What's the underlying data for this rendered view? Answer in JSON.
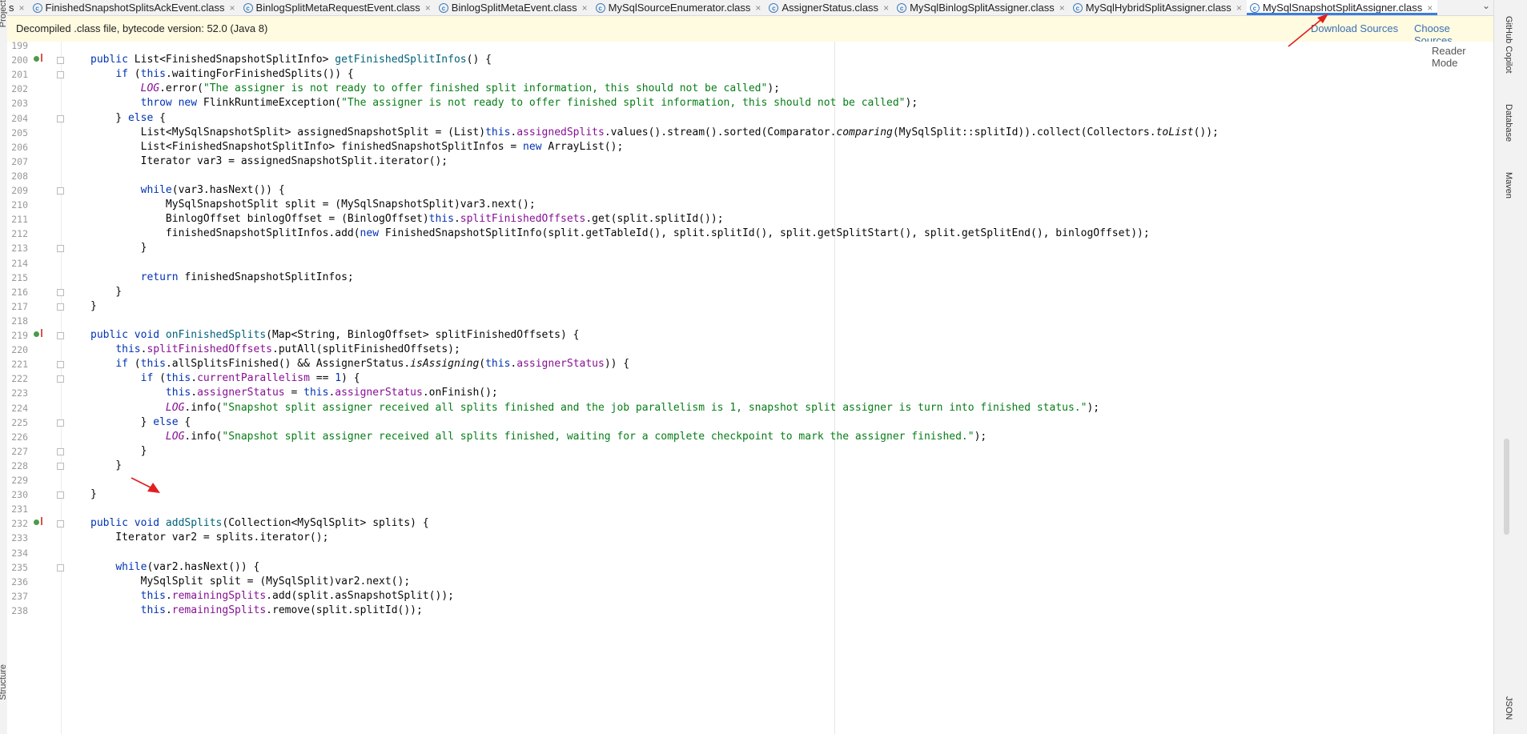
{
  "tabs": [
    {
      "label": "s",
      "active": false,
      "icon": "class-file-icon"
    },
    {
      "label": "FinishedSnapshotSplitsAckEvent.class",
      "active": false,
      "icon": "class-file-icon"
    },
    {
      "label": "BinlogSplitMetaRequestEvent.class",
      "active": false,
      "icon": "class-file-icon"
    },
    {
      "label": "BinlogSplitMetaEvent.class",
      "active": false,
      "icon": "class-file-icon"
    },
    {
      "label": "MySqlSourceEnumerator.class",
      "active": false,
      "icon": "class-file-icon"
    },
    {
      "label": "AssignerStatus.class",
      "active": false,
      "icon": "class-file-icon"
    },
    {
      "label": "MySqlBinlogSplitAssigner.class",
      "active": false,
      "icon": "class-file-icon"
    },
    {
      "label": "MySqlHybridSplitAssigner.class",
      "active": false,
      "icon": "class-file-icon"
    },
    {
      "label": "MySqlSnapshotSplitAssigner.class",
      "active": true,
      "icon": "class-file-icon"
    }
  ],
  "banner": {
    "message": "Decompiled .class file, bytecode version: 52.0 (Java 8)",
    "download_sources": "Download Sources",
    "choose_sources": "Choose Sources..."
  },
  "editor": {
    "reader_mode": "Reader Mode",
    "lines": [
      {
        "n": "199",
        "marker": false,
        "fold": false,
        "code": ""
      },
      {
        "n": "200",
        "marker": true,
        "fold": true,
        "code": "<span class=\"kw\">public</span> List&lt;FinishedSnapshotSplitInfo&gt; <span class=\"mth\">getFinishedSplitInfos</span>() {"
      },
      {
        "n": "201",
        "marker": false,
        "fold": true,
        "code": "    <span class=\"kw\">if</span> (<span class=\"kw\">this</span>.waitingForFinishedSplits()) {"
      },
      {
        "n": "202",
        "marker": false,
        "fold": false,
        "code": "        <span class=\"fld it\">LOG</span>.error(<span class=\"str\">\"The assigner is not ready to offer finished split information, this should not be called\"</span>);"
      },
      {
        "n": "203",
        "marker": false,
        "fold": false,
        "code": "        <span class=\"kw\">throw new</span> FlinkRuntimeException(<span class=\"str\">\"The assigner is not ready to offer finished split information, this should not be called\"</span>);"
      },
      {
        "n": "204",
        "marker": false,
        "fold": true,
        "code": "    } <span class=\"kw\">else</span> {"
      },
      {
        "n": "205",
        "marker": false,
        "fold": false,
        "code": "        List&lt;MySqlSnapshotSplit&gt; assignedSnapshotSplit = (List)<span class=\"kw\">this</span>.<span class=\"fld\">assignedSplits</span>.values().stream().sorted(Comparator.<span class=\"it\">comparing</span>(MySqlSplit::splitId)).collect(Collectors.<span class=\"it\">toList</span>());"
      },
      {
        "n": "206",
        "marker": false,
        "fold": false,
        "code": "        List&lt;FinishedSnapshotSplitInfo&gt; finishedSnapshotSplitInfos = <span class=\"kw\">new</span> ArrayList();"
      },
      {
        "n": "207",
        "marker": false,
        "fold": false,
        "code": "        Iterator var3 = assignedSnapshotSplit.iterator();"
      },
      {
        "n": "208",
        "marker": false,
        "fold": false,
        "code": ""
      },
      {
        "n": "209",
        "marker": false,
        "fold": true,
        "code": "        <span class=\"kw\">while</span>(var3.hasNext()) {"
      },
      {
        "n": "210",
        "marker": false,
        "fold": false,
        "code": "            MySqlSnapshotSplit split = (MySqlSnapshotSplit)var3.next();"
      },
      {
        "n": "211",
        "marker": false,
        "fold": false,
        "code": "            BinlogOffset binlogOffset = (BinlogOffset)<span class=\"kw\">this</span>.<span class=\"fld\">splitFinishedOffsets</span>.get(split.splitId());"
      },
      {
        "n": "212",
        "marker": false,
        "fold": false,
        "code": "            finishedSnapshotSplitInfos.add(<span class=\"kw\">new</span> FinishedSnapshotSplitInfo(split.getTableId(), split.splitId(), split.getSplitStart(), split.getSplitEnd(), binlogOffset));"
      },
      {
        "n": "213",
        "marker": false,
        "fold": true,
        "code": "        }"
      },
      {
        "n": "214",
        "marker": false,
        "fold": false,
        "code": ""
      },
      {
        "n": "215",
        "marker": false,
        "fold": false,
        "code": "        <span class=\"kw\">return</span> finishedSnapshotSplitInfos;"
      },
      {
        "n": "216",
        "marker": false,
        "fold": true,
        "code": "    }"
      },
      {
        "n": "217",
        "marker": false,
        "fold": true,
        "code": "}"
      },
      {
        "n": "218",
        "marker": false,
        "fold": false,
        "code": ""
      },
      {
        "n": "219",
        "marker": true,
        "fold": true,
        "code": "<span class=\"kw\">public void</span> <span class=\"mth\">onFinishedSplits</span>(Map&lt;String, BinlogOffset&gt; splitFinishedOffsets) {"
      },
      {
        "n": "220",
        "marker": false,
        "fold": false,
        "code": "    <span class=\"kw\">this</span>.<span class=\"fld\">splitFinishedOffsets</span>.putAll(splitFinishedOffsets);"
      },
      {
        "n": "221",
        "marker": false,
        "fold": true,
        "code": "    <span class=\"kw\">if</span> (<span class=\"kw\">this</span>.allSplitsFinished() &amp;&amp; AssignerStatus.<span class=\"it\">isAssigning</span>(<span class=\"kw\">this</span>.<span class=\"fld\">assignerStatus</span>)) {"
      },
      {
        "n": "222",
        "marker": false,
        "fold": true,
        "code": "        <span class=\"kw\">if</span> (<span class=\"kw\">this</span>.<span class=\"fld\">currentParallelism</span> == <span class=\"kw\">1</span>) {"
      },
      {
        "n": "223",
        "marker": false,
        "fold": false,
        "code": "            <span class=\"kw\">this</span>.<span class=\"fld\">assignerStatus</span> = <span class=\"kw\">this</span>.<span class=\"fld\">assignerStatus</span>.onFinish();"
      },
      {
        "n": "224",
        "marker": false,
        "fold": false,
        "code": "            <span class=\"fld it\">LOG</span>.info(<span class=\"str\">\"Snapshot split assigner received all splits finished and the job parallelism is 1, snapshot split assigner is turn into finished status.\"</span>);"
      },
      {
        "n": "225",
        "marker": false,
        "fold": true,
        "code": "        } <span class=\"kw\">else</span> {"
      },
      {
        "n": "226",
        "marker": false,
        "fold": false,
        "code": "            <span class=\"fld it\">LOG</span>.info(<span class=\"str\">\"Snapshot split assigner received all splits finished, waiting for a complete checkpoint to mark the assigner finished.\"</span>);"
      },
      {
        "n": "227",
        "marker": false,
        "fold": true,
        "code": "        }"
      },
      {
        "n": "228",
        "marker": false,
        "fold": true,
        "code": "    }"
      },
      {
        "n": "229",
        "marker": false,
        "fold": false,
        "code": ""
      },
      {
        "n": "230",
        "marker": false,
        "fold": true,
        "code": "}"
      },
      {
        "n": "231",
        "marker": false,
        "fold": false,
        "code": ""
      },
      {
        "n": "232",
        "marker": true,
        "fold": true,
        "code": "<span class=\"kw\">public void</span> <span class=\"mth\">addSplits</span>(Collection&lt;MySqlSplit&gt; splits) {"
      },
      {
        "n": "233",
        "marker": false,
        "fold": false,
        "code": "    Iterator var2 = splits.iterator();"
      },
      {
        "n": "234",
        "marker": false,
        "fold": false,
        "code": ""
      },
      {
        "n": "235",
        "marker": false,
        "fold": true,
        "code": "    <span class=\"kw\">while</span>(var2.hasNext()) {"
      },
      {
        "n": "236",
        "marker": false,
        "fold": false,
        "code": "        MySqlSplit split = (MySqlSplit)var2.next();"
      },
      {
        "n": "237",
        "marker": false,
        "fold": false,
        "code": "        <span class=\"kw\">this</span>.<span class=\"fld\">remainingSplits</span>.add(split.asSnapshotSplit());"
      },
      {
        "n": "238",
        "marker": false,
        "fold": false,
        "code": "        <span class=\"kw\">this</span>.<span class=\"fld\">remainingSplits</span>.remove(split.splitId());"
      }
    ]
  },
  "side_panels": {
    "left": {
      "project": "Project",
      "structure": "Structure"
    },
    "right": {
      "copilot": "GitHub Copilot",
      "database": "Database",
      "maven": "Maven",
      "json": "JSON"
    }
  },
  "colors": {
    "annotation_arrow": "#e02020",
    "active_tab_underline": "#3b7ddd",
    "banner_bg": "#fffbe0"
  }
}
